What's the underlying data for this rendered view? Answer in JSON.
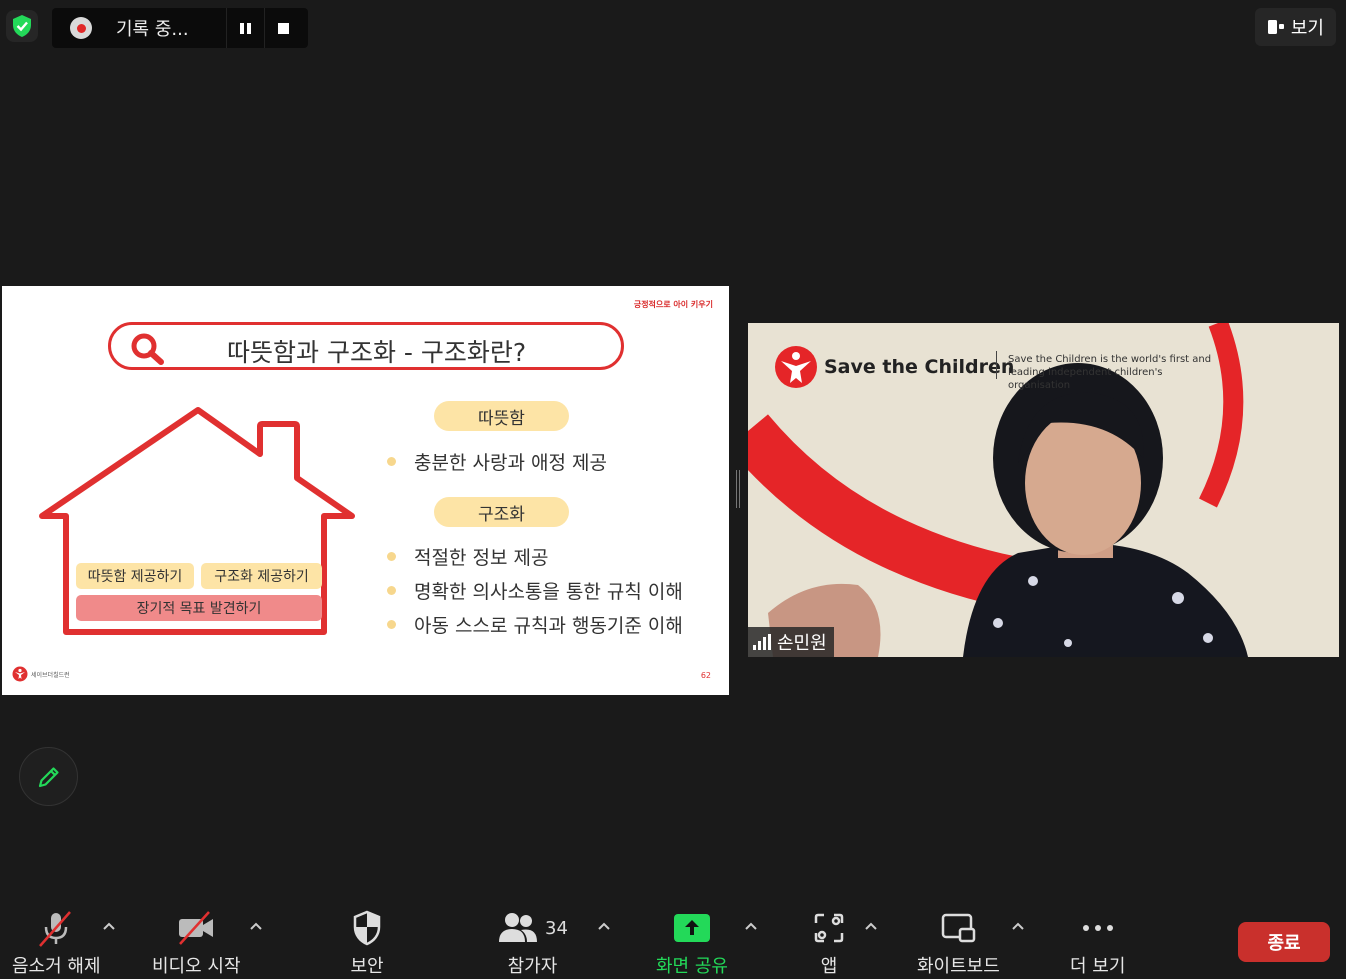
{
  "recording": {
    "label": "기록 중..."
  },
  "view_button": {
    "label": "보기"
  },
  "slide": {
    "header": "긍정적으로 아이 키우기",
    "title": "따뜻함과 구조화 - 구조화란?",
    "sections": [
      {
        "pill": "따뜻함",
        "items": [
          "충분한 사랑과 애정 제공"
        ]
      },
      {
        "pill": "구조화",
        "items": [
          "적절한 정보 제공",
          "명확한 의사소통을 통한 규칙 이해",
          "아동 스스로 규칙과 행동기준 이해"
        ]
      }
    ],
    "house_tags": [
      "따뜻함 제공하기",
      "구조화 제공하기",
      "장기적 목표 발견하기"
    ],
    "logo_text": "세이브더칠드런",
    "page_number": "62"
  },
  "video": {
    "brand": "Save the Children",
    "tagline": "Save the Children is the world's first and leading independent children's organisation",
    "participant_name": "손민원"
  },
  "toolbar": {
    "mute_label": "음소거 해제",
    "video_label": "비디오 시작",
    "security_label": "보안",
    "participants_label": "참가자",
    "participants_count": "34",
    "share_label": "화면 공유",
    "apps_label": "앱",
    "whiteboard_label": "화이트보드",
    "more_label": "더 보기",
    "end_label": "종료"
  },
  "colors": {
    "background": "#1a1a1a",
    "accent_red": "#e03030",
    "share_green": "#23d959",
    "end_red": "#c9302c",
    "pill_yellow": "#fde4a6",
    "tag_pink": "#f08a8a"
  }
}
